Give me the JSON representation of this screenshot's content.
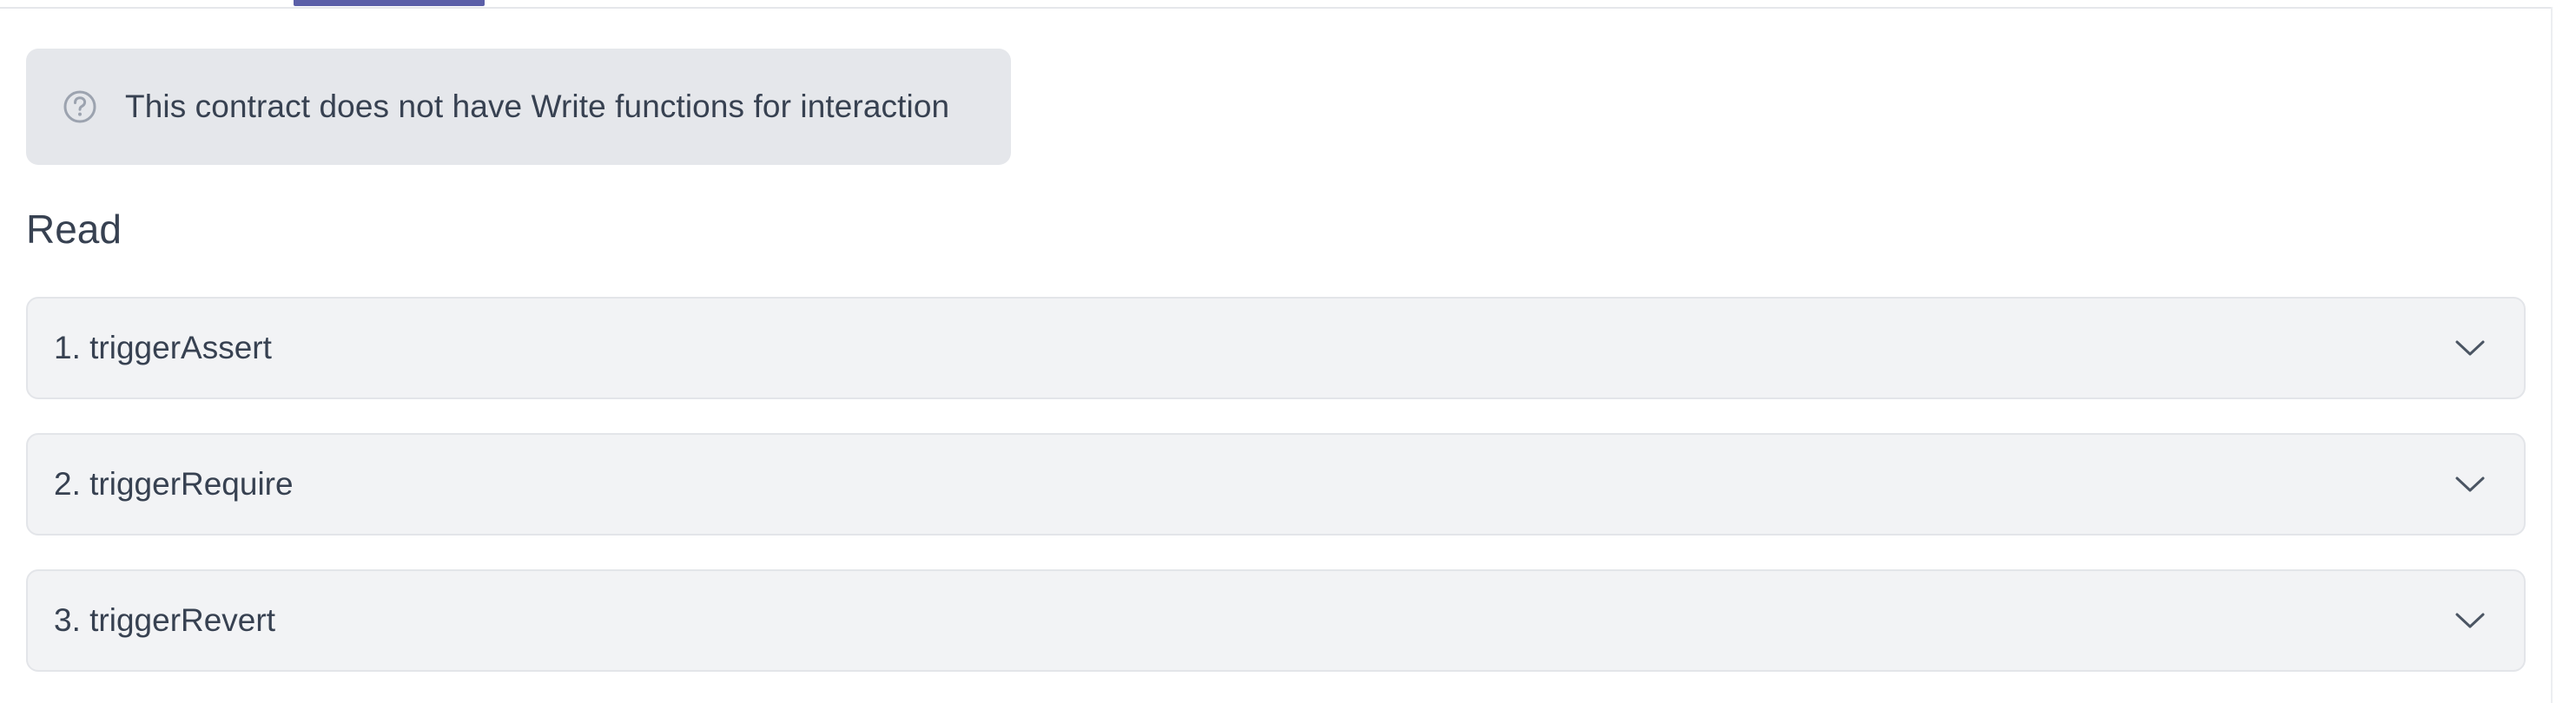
{
  "notice": {
    "icon": "question-circle-icon",
    "text": "This contract does not have Write functions for interaction"
  },
  "read": {
    "title": "Read",
    "functions": [
      {
        "label": "1. triggerAssert",
        "icon": "chevron-down-icon"
      },
      {
        "label": "2. triggerRequire",
        "icon": "chevron-down-icon"
      },
      {
        "label": "3. triggerRevert",
        "icon": "chevron-down-icon"
      }
    ]
  },
  "colors": {
    "active_tab": "#5b5fa8",
    "notice_bg": "#e5e7eb",
    "row_bg": "#f2f3f5",
    "text": "#374151"
  }
}
